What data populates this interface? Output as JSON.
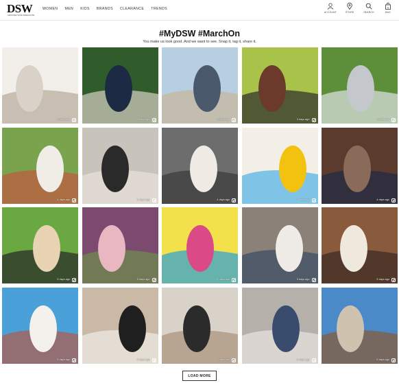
{
  "brand": {
    "logo": "DSW",
    "tagline": "DESIGNER SHOE WAREHOUSE"
  },
  "nav": [
    "WOMEN",
    "MEN",
    "KIDS",
    "BRANDS",
    "CLEARANCE",
    "TRENDS"
  ],
  "actions": [
    {
      "label": "ACCOUNT",
      "icon": "account-icon"
    },
    {
      "label": "STORE",
      "icon": "store-icon"
    },
    {
      "label": "SEARCH",
      "icon": "search-icon"
    },
    {
      "label": "BAG",
      "icon": "bag-icon",
      "count": "0"
    }
  ],
  "page": {
    "title": "#MyDSW #MarchOn",
    "subtitle": "You make us look good. And we want to see. Snap it, tag it, share it."
  },
  "photos": [
    {
      "days": "2 days ago",
      "colors": [
        "#f2efea",
        "#d9d2c8",
        "#b7a99a"
      ]
    },
    {
      "days": "3 days ago",
      "colors": [
        "#2f5c2a",
        "#1d2a44",
        "#d8d0c6"
      ]
    },
    {
      "days": "3 days ago",
      "colors": [
        "#b7cfe3",
        "#4a5a6c",
        "#c8b59a"
      ]
    },
    {
      "days": "3 days ago",
      "colors": [
        "#a9c24a",
        "#6b3a2a",
        "#2b2b2b"
      ]
    },
    {
      "days": "3 days ago",
      "colors": [
        "#5d8f3a",
        "#c4c8cc",
        "#dfe3e6"
      ]
    },
    {
      "days": "4 days ago",
      "colors": [
        "#7aa34d",
        "#f0ece6",
        "#c2593e"
      ]
    },
    {
      "days": "5 days ago",
      "colors": [
        "#c9c4bb",
        "#2a2a2a",
        "#e8e3dc"
      ]
    },
    {
      "days": "4 days ago",
      "colors": [
        "#6d6d6d",
        "#efeae4",
        "#3a3a3a"
      ]
    },
    {
      "days": "4 days ago",
      "colors": [
        "#f4efe6",
        "#f2c20f",
        "#4db2e6"
      ]
    },
    {
      "days": "4 days ago",
      "colors": [
        "#5b3b2e",
        "#8a6b5a",
        "#1f2b46"
      ]
    },
    {
      "days": "5 days ago",
      "colors": [
        "#6aa842",
        "#e8d3b3",
        "#262626"
      ]
    },
    {
      "days": "5 days ago",
      "colors": [
        "#7b4a6e",
        "#e8b7c2",
        "#6f8f4a"
      ]
    },
    {
      "days": "5 days ago",
      "colors": [
        "#f2e14a",
        "#d94a87",
        "#2b9fd9"
      ]
    },
    {
      "days": "5 days ago",
      "colors": [
        "#8b8179",
        "#efece8",
        "#3b4b63"
      ]
    },
    {
      "days": "5 days ago",
      "colors": [
        "#8a5a3c",
        "#efe8dd",
        "#3a2a22"
      ]
    },
    {
      "days": "5 days ago",
      "colors": [
        "#4aa0d8",
        "#f4f1ec",
        "#b25a4a"
      ]
    },
    {
      "days": "6 days ago",
      "colors": [
        "#c9b9a6",
        "#1f1f1f",
        "#f0ede8"
      ]
    },
    {
      "days": "6 days ago",
      "colors": [
        "#d9d2c8",
        "#2b2b2b",
        "#a8917a"
      ]
    },
    {
      "days": "6 days ago",
      "colors": [
        "#b6b0aa",
        "#3a4c6e",
        "#e9e5e0"
      ]
    },
    {
      "days": "6 days ago",
      "colors": [
        "#4a8ac8",
        "#cfc3b0",
        "#8a5a32"
      ]
    }
  ],
  "load_more": "LOAD MORE"
}
